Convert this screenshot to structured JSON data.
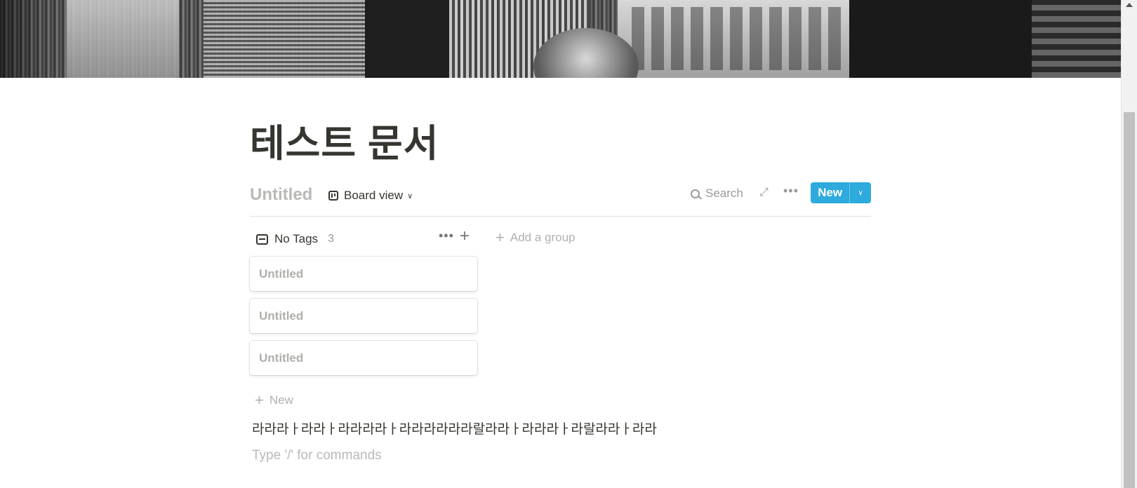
{
  "page": {
    "title": "테스트 문서"
  },
  "database": {
    "title": "Untitled",
    "view_label": "Board view",
    "search_label": "Search",
    "new_label": "New"
  },
  "board": {
    "group": {
      "label": "No Tags",
      "count": "3"
    },
    "add_group_label": "Add a group",
    "cards": [
      {
        "title": "Untitled"
      },
      {
        "title": "Untitled"
      },
      {
        "title": "Untitled"
      }
    ],
    "new_card_label": "New"
  },
  "content": {
    "paragraph": "라라라ㅏ라라ㅏ라라라라ㅏ라라라라라라랄라라ㅏ라라라ㅏ라랄라라ㅏ라라",
    "placeholder": "Type '/' for commands"
  },
  "colors": {
    "accent": "#2eaadc",
    "text": "#37352f",
    "muted": "#9b9a97"
  },
  "icons": [
    "board-view-icon",
    "chevron-down-icon",
    "search-icon",
    "expand-icon",
    "more-icon",
    "inbox-icon",
    "plus-icon",
    "scroll-up-icon"
  ]
}
